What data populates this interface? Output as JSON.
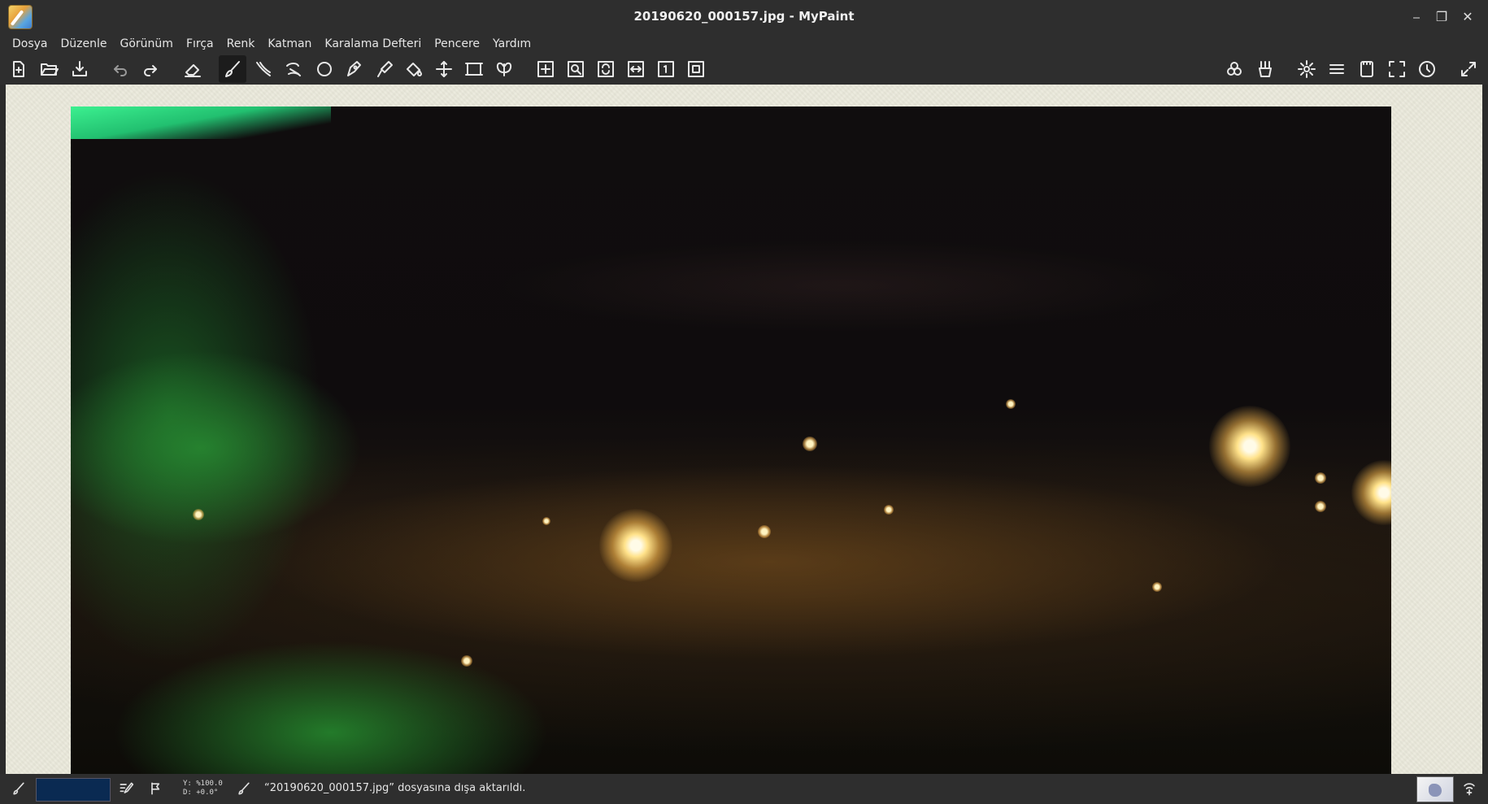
{
  "window": {
    "title": "20190620_000157.jpg - MyPaint",
    "minimize_label": "⎯",
    "maximize_label": "❐",
    "close_label": "✕"
  },
  "menubar": {
    "items": [
      "Dosya",
      "Düzenle",
      "Görünüm",
      "Fırça",
      "Renk",
      "Katman",
      "Karalama Defteri",
      "Pencere",
      "Yardım"
    ]
  },
  "toolbar": {
    "left_icons": [
      "new-document-icon",
      "open-folder-icon",
      "save-icon",
      "undo-icon",
      "redo-icon",
      "eraser-icon",
      "brush-icon",
      "inking-icon",
      "lasso-icon",
      "ellipse-icon",
      "pen-icon",
      "color-picker-icon",
      "fill-bucket-icon",
      "move-layer-icon",
      "frame-icon",
      "symmetry-icon",
      "pan-icon",
      "zoom-icon",
      "rotate-icon",
      "flip-icon",
      "reset-view-icon",
      "fit-view-icon"
    ],
    "right_icons": [
      "color-circles-icon",
      "brushes-icon",
      "settings-gear-icon",
      "layers-icon",
      "scratchpad-icon",
      "fullscreen-icon",
      "history-clock-icon",
      "expand-icon"
    ],
    "active_tool": "brush-icon"
  },
  "document": {
    "filename": "20190620_000157.jpg"
  },
  "statusbar": {
    "current_color": "#0a2a52",
    "coord_line1": "Y: %100.0",
    "coord_line2": "D: +0.0°",
    "message": "“20190620_000157.jpg” dosyasına dışa aktarıldı."
  },
  "colors": {
    "chrome_bg": "#2e2e2e",
    "canvas_paper": "#ebeadc",
    "accent_color": "#0a2a52"
  }
}
